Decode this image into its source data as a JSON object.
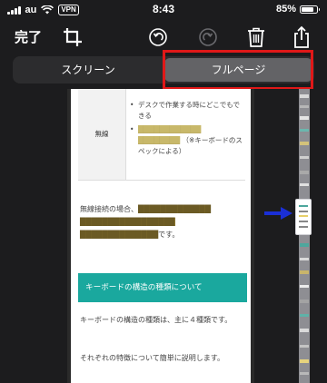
{
  "status_bar": {
    "carrier": "au",
    "vpn": "VPN",
    "time": "8:43",
    "battery_percent": "85%",
    "battery_level": 0.85
  },
  "toolbar": {
    "done_label": "完了",
    "icons": [
      "crop-icon",
      "undo-icon",
      "redo-icon",
      "trash-icon",
      "share-icon"
    ]
  },
  "segment": {
    "left_label": "スクリーン",
    "right_label": "フルページ",
    "selected": "フルページ"
  },
  "document": {
    "spec_table": {
      "label": "無線",
      "items": [
        "デスクで作業する時にどこでもできる",
        "（※キーボードのスペックによる）"
      ]
    },
    "paragraph1": {
      "lead": "無線接続の場合、",
      "tail": "です。"
    },
    "section_heading": "キーボードの構造の種類について",
    "paragraph2": "キーボードの構造の種類は、主に４種類です。",
    "paragraph3": "それぞれの特徴について簡単に説明します。"
  },
  "colors": {
    "highlight_border": "#e01818",
    "section_heading_bg": "#1aa89e",
    "arrow": "#1a2fd6",
    "marker": "#f2d24a"
  }
}
